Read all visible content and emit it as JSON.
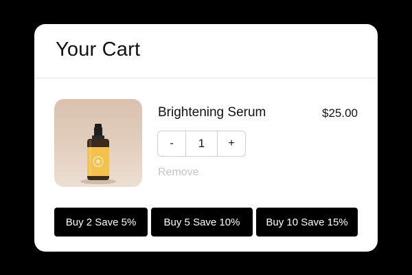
{
  "cart": {
    "title": "Your Cart"
  },
  "item": {
    "name": "Brightening Serum",
    "price": "$25.00",
    "quantity": "1",
    "decrement_label": "-",
    "increment_label": "+",
    "remove_label": "Remove",
    "image_icon": "serum-bottle-icon"
  },
  "bundles": [
    {
      "label": "Buy 2 Save 5%"
    },
    {
      "label": "Buy 5 Save 10%"
    },
    {
      "label": "Buy 10 Save 15%"
    }
  ],
  "colors": {
    "background": "#000000",
    "card": "#ffffff",
    "button_bg": "#000000",
    "button_text": "#ffffff",
    "remove_text": "#c4c4c4",
    "bottle_label": "#f2c14e",
    "image_bg": "#dcc6b4"
  }
}
